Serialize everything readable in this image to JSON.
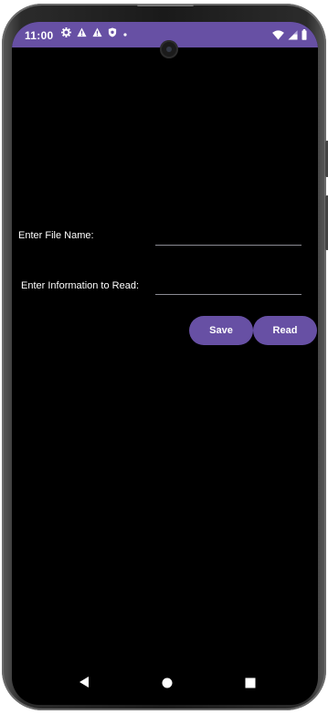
{
  "status_bar": {
    "time": "11:00",
    "icons": [
      "gear-icon",
      "warning-icon",
      "warning-icon",
      "shield-icon",
      "dot-icon"
    ],
    "right_icons": [
      "wifi-icon",
      "signal-icon",
      "battery-icon"
    ],
    "color": "#6750a4"
  },
  "form": {
    "file_name_label": "Enter File Name:",
    "file_name_value": "",
    "info_label": "Enter Information to Read:",
    "info_value": ""
  },
  "buttons": {
    "save_label": "Save",
    "read_label": "Read",
    "color": "#6750a4"
  },
  "nav_bar": {
    "icons": [
      "back-icon",
      "home-icon",
      "recents-icon"
    ]
  }
}
